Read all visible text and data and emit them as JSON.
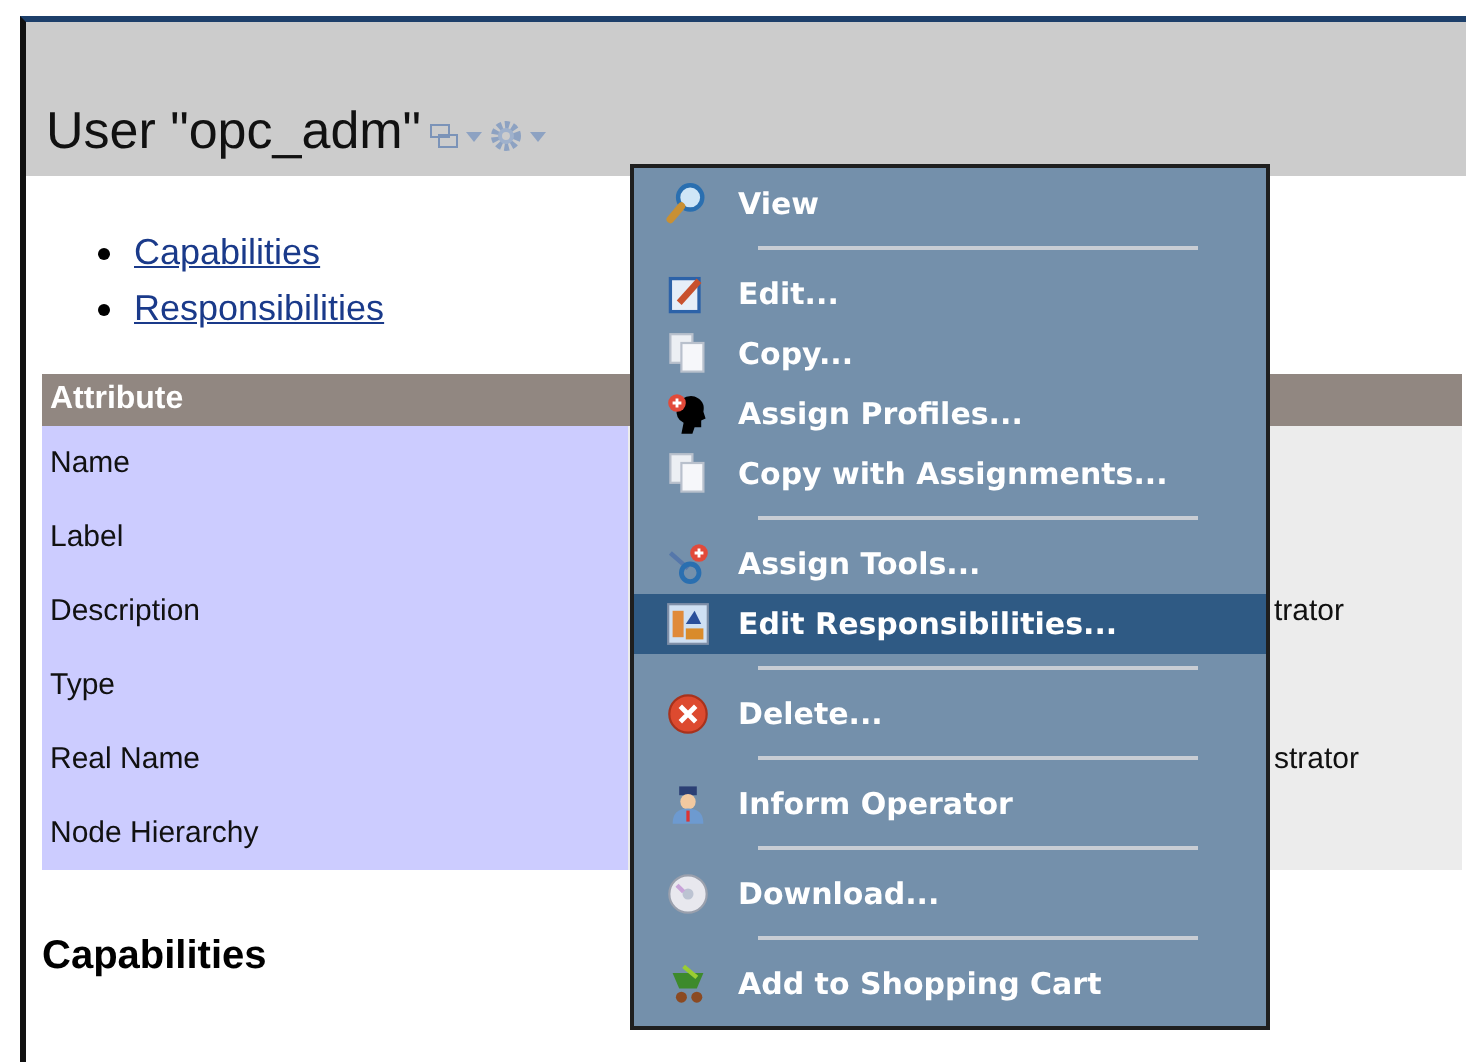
{
  "header": {
    "title": "User \"opc_adm\""
  },
  "links": [
    "Capabilities",
    "Responsibilities"
  ],
  "table": {
    "columns": [
      "Attribute"
    ],
    "rows": [
      {
        "attribute": "Name",
        "value": ""
      },
      {
        "attribute": "Label",
        "value": ""
      },
      {
        "attribute": "Description",
        "value": "trator"
      },
      {
        "attribute": "Type",
        "value": ""
      },
      {
        "attribute": "Real Name",
        "value": "strator"
      },
      {
        "attribute": "Node Hierarchy",
        "value": ""
      }
    ]
  },
  "section_heading": "Capabilities",
  "context_menu": [
    {
      "kind": "item",
      "label": "View",
      "selected": false
    },
    {
      "kind": "separator"
    },
    {
      "kind": "item",
      "label": "Edit...",
      "selected": false
    },
    {
      "kind": "item",
      "label": "Copy...",
      "selected": false
    },
    {
      "kind": "item",
      "label": "Assign Profiles...",
      "selected": false
    },
    {
      "kind": "item",
      "label": "Copy with Assignments...",
      "selected": false
    },
    {
      "kind": "separator"
    },
    {
      "kind": "item",
      "label": "Assign Tools...",
      "selected": false
    },
    {
      "kind": "item",
      "label": "Edit Responsibilities...",
      "selected": true
    },
    {
      "kind": "separator"
    },
    {
      "kind": "item",
      "label": "Delete...",
      "selected": false
    },
    {
      "kind": "separator"
    },
    {
      "kind": "item",
      "label": "Inform Operator",
      "selected": false
    },
    {
      "kind": "separator"
    },
    {
      "kind": "item",
      "label": "Download...",
      "selected": false
    },
    {
      "kind": "separator"
    },
    {
      "kind": "item",
      "label": "Add to Shopping Cart",
      "selected": false
    }
  ]
}
